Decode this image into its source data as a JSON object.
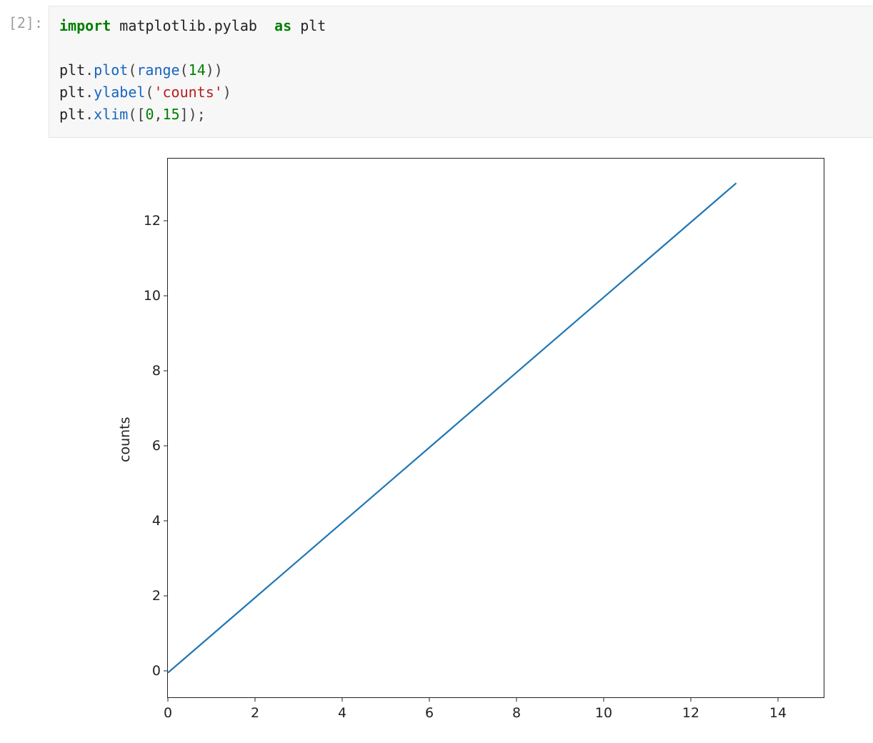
{
  "cell": {
    "prompt": "[2]:",
    "code": {
      "l1": {
        "kw_import": "import",
        "module": "matplotlib.pylab",
        "kw_as": "as",
        "alias": "plt"
      },
      "l2": {
        "obj": "plt",
        "dot": ".",
        "fn": "plot",
        "open": "(",
        "rng": "range",
        "open2": "(",
        "num": "14",
        "close2": ")",
        "close": ")"
      },
      "l3": {
        "obj": "plt",
        "dot": ".",
        "fn": "ylabel",
        "open": "(",
        "str": "'counts'",
        "close": ")"
      },
      "l4": {
        "obj": "plt",
        "dot": ".",
        "fn": "xlim",
        "open": "(",
        "lb": "[",
        "n0": "0",
        "comma": ",",
        "n1": "15",
        "rb": "]",
        "close": ")",
        "semi": ";"
      }
    }
  },
  "chart_data": {
    "type": "line",
    "x": [
      0,
      1,
      2,
      3,
      4,
      5,
      6,
      7,
      8,
      9,
      10,
      11,
      12,
      13
    ],
    "y": [
      0,
      1,
      2,
      3,
      4,
      5,
      6,
      7,
      8,
      9,
      10,
      11,
      12,
      13
    ],
    "xlabel": "",
    "ylabel": "counts",
    "xlim": [
      0,
      15
    ],
    "ylim": [
      -0.65,
      13.65
    ],
    "xticks": [
      0,
      2,
      4,
      6,
      8,
      10,
      12,
      14
    ],
    "yticks": [
      0,
      2,
      4,
      6,
      8,
      10,
      12
    ],
    "line_color": "#1f77b4"
  }
}
